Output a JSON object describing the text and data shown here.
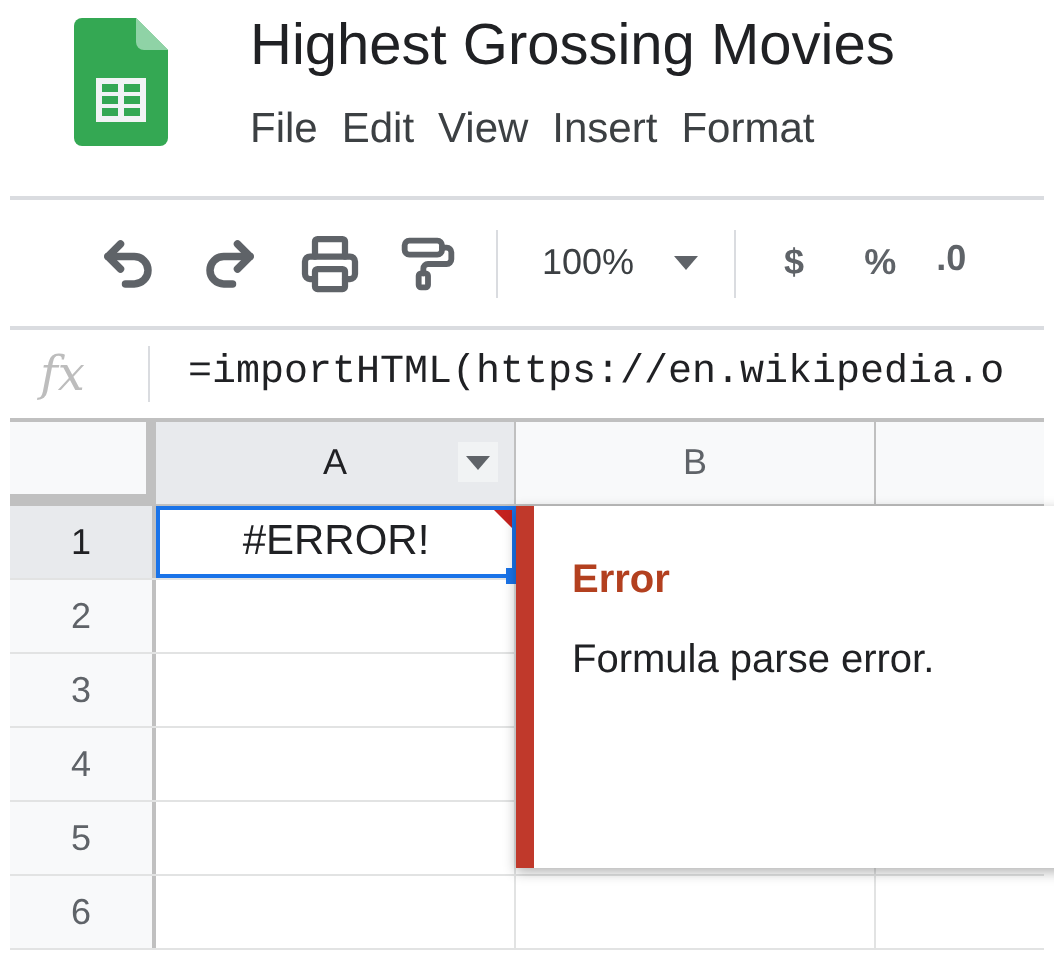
{
  "document": {
    "title": "Highest Grossing Movies"
  },
  "menu": [
    {
      "label": "File"
    },
    {
      "label": "Edit"
    },
    {
      "label": "View"
    },
    {
      "label": "Insert"
    },
    {
      "label": "Format"
    }
  ],
  "toolbar": {
    "zoom": "100%",
    "currency": "$",
    "percent": "%",
    "decimal": ".0"
  },
  "formula_bar": {
    "label": "fx",
    "formula": "=importHTML(https://en.wikipedia.o"
  },
  "columns": [
    {
      "label": "A",
      "selected": true
    },
    {
      "label": "B",
      "selected": false
    }
  ],
  "rows": [
    {
      "label": "1",
      "selected": true,
      "cells": [
        {
          "value": "#ERROR!",
          "selected": true,
          "error": true
        }
      ]
    },
    {
      "label": "2",
      "selected": false
    },
    {
      "label": "3",
      "selected": false
    },
    {
      "label": "4",
      "selected": false
    },
    {
      "label": "5",
      "selected": false
    },
    {
      "label": "6",
      "selected": false
    }
  ],
  "error_popup": {
    "title": "Error",
    "message": "Formula parse error."
  }
}
